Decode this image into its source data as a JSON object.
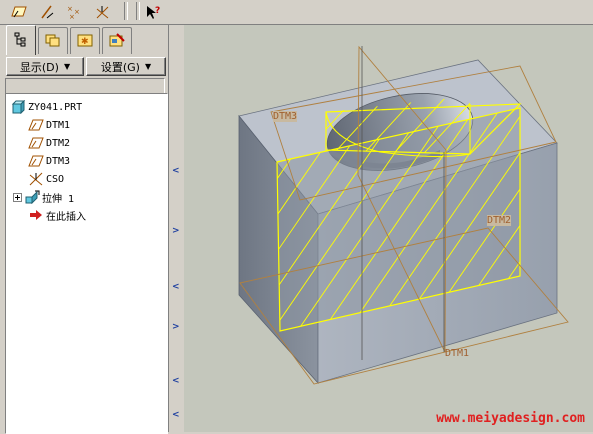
{
  "toolbar": {
    "buttons": [
      {
        "icon": "datum-plane-icon"
      },
      {
        "icon": "datum-axis-icon"
      },
      {
        "icon": "datum-point-icon"
      },
      {
        "icon": "coordinate-system-icon"
      },
      {
        "icon": "whats-this-help-icon"
      }
    ]
  },
  "panel": {
    "tabs": [
      {
        "icon": "model-tree-icon"
      },
      {
        "icon": "folder-browser-icon"
      },
      {
        "icon": "favorites-icon"
      },
      {
        "icon": "connections-icon"
      }
    ],
    "show_label": "显示(D)",
    "settings_label": "设置(G)",
    "tree": {
      "root": "ZY041.PRT",
      "items": [
        {
          "label": "DTM1",
          "icon": "datum-plane-icon"
        },
        {
          "label": "DTM2",
          "icon": "datum-plane-icon"
        },
        {
          "label": "DTM3",
          "icon": "datum-plane-icon"
        },
        {
          "label": "CSO",
          "icon": "coordinate-system-icon"
        },
        {
          "label": "拉伸 1",
          "icon": "extrude-icon"
        },
        {
          "label": "在此插入",
          "icon": "insert-here-arrow-icon"
        }
      ]
    }
  },
  "viewport": {
    "datum_labels": {
      "dtm1": "DTM1",
      "dtm2": "DTM2",
      "dtm3": "DTM3"
    },
    "watermark": "www.meiyadesign.com"
  },
  "colors": {
    "background": "#c4c7bc",
    "part_top": "#bfc5cf",
    "part_front": "#9ca4b0",
    "part_side": "#7f8794",
    "highlight": "#ffff00",
    "datum": "#b08040",
    "watermark": "#e02020"
  }
}
